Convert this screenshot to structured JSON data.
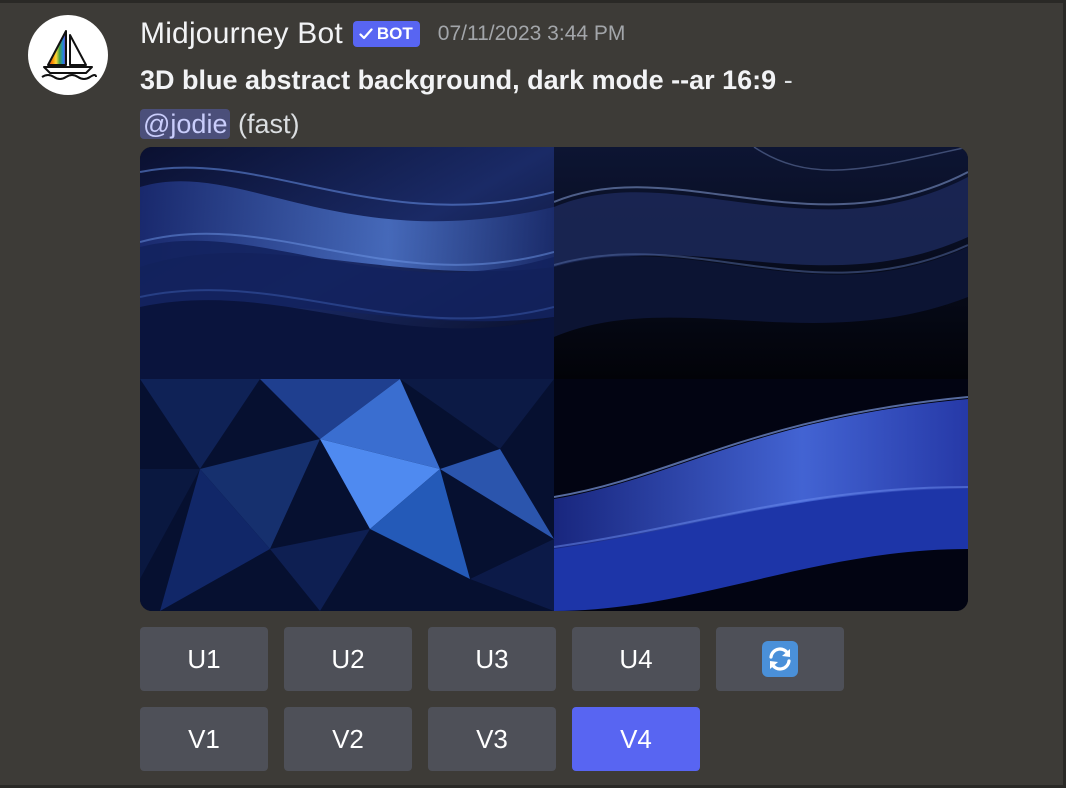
{
  "message": {
    "author": "Midjourney Bot",
    "bot_tag": "BOT",
    "timestamp": "07/11/2023 3:44 PM",
    "prompt": "3D blue abstract background, dark mode --ar 16:9",
    "separator": "-",
    "mention": "@jodie",
    "speed": "(fast)"
  },
  "image_grid": {
    "tiles": [
      "image-1",
      "image-2",
      "image-3",
      "image-4"
    ]
  },
  "buttons": {
    "upscale": [
      "U1",
      "U2",
      "U3",
      "U4"
    ],
    "reroll_icon": "refresh-icon",
    "variation": [
      "V1",
      "V2",
      "V3",
      "V4"
    ],
    "active": "V4"
  },
  "colors": {
    "background": "#3d3b37",
    "button": "#4e5058",
    "button_active": "#5865f2",
    "bot_tag": "#5865f2",
    "mention_bg": "#4b4f7a",
    "mention_text": "#c9cdfb"
  }
}
